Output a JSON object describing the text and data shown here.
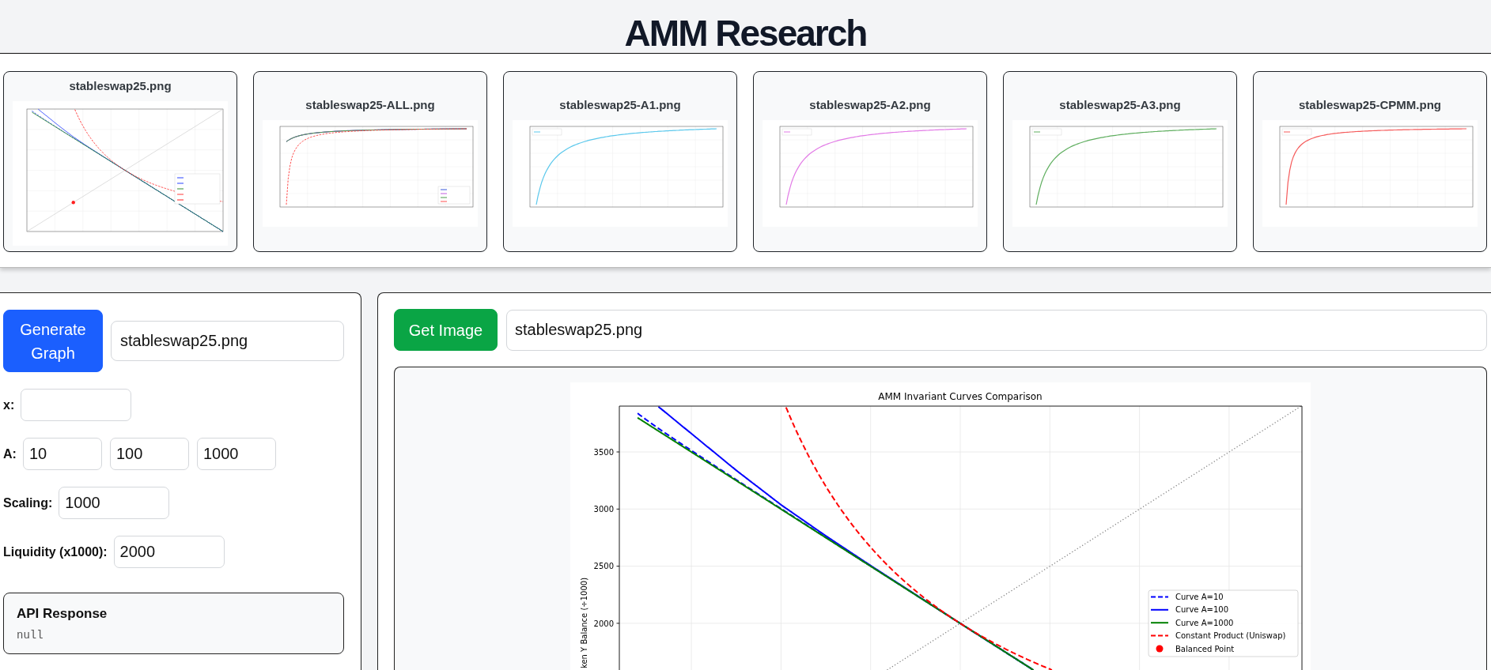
{
  "header": {
    "title": "AMM Research"
  },
  "thumbnails": [
    {
      "title": "stableswap25.png",
      "kind": "invariant"
    },
    {
      "title": "stableswap25-ALL.png",
      "kind": "comparison"
    },
    {
      "title": "stableswap25-A1.png",
      "kind": "slippage",
      "color": "#5bc8ec"
    },
    {
      "title": "stableswap25-A2.png",
      "kind": "slippage",
      "color": "#e27be6"
    },
    {
      "title": "stableswap25-A3.png",
      "kind": "slippage",
      "color": "#5fae5f"
    },
    {
      "title": "stableswap25-CPMM.png",
      "kind": "cpmm",
      "color": "#f55b5b"
    }
  ],
  "generator": {
    "button": "Generate Graph",
    "filename_input": {
      "value": "stableswap25.png"
    },
    "fields": [
      {
        "label": "x:"
      },
      {
        "label": "A:",
        "values": [
          "10",
          "100",
          "1000"
        ]
      },
      {
        "label": "Scaling:",
        "values": [
          "1000"
        ]
      },
      {
        "label": "Liquidity (x1000):",
        "values": [
          "2000"
        ]
      }
    ],
    "api_response": {
      "title": "API Response",
      "body": "null"
    }
  },
  "viewer": {
    "button": "Get Image",
    "filename_input": {
      "value": "stableswap25.png"
    },
    "chart": {
      "title": "AMM Invariant Curves Comparison",
      "y_axis_label": "ken Y Balance (÷1000)",
      "y_tick_labels": [
        "3500",
        "3000",
        "2500",
        "2000"
      ],
      "legend": [
        {
          "label": "Curve A=10",
          "kind": "dashed",
          "color": "#0000ff"
        },
        {
          "label": "Curve A=100",
          "kind": "solid",
          "color": "#0000ff"
        },
        {
          "label": "Curve A=1000",
          "kind": "solid",
          "color": "#008000"
        },
        {
          "label": "Constant Product (Uniswap)",
          "kind": "dashed",
          "color": "#ff0000"
        },
        {
          "label": "Balanced Point",
          "kind": "marker",
          "color": "#ff0000"
        }
      ]
    }
  }
}
